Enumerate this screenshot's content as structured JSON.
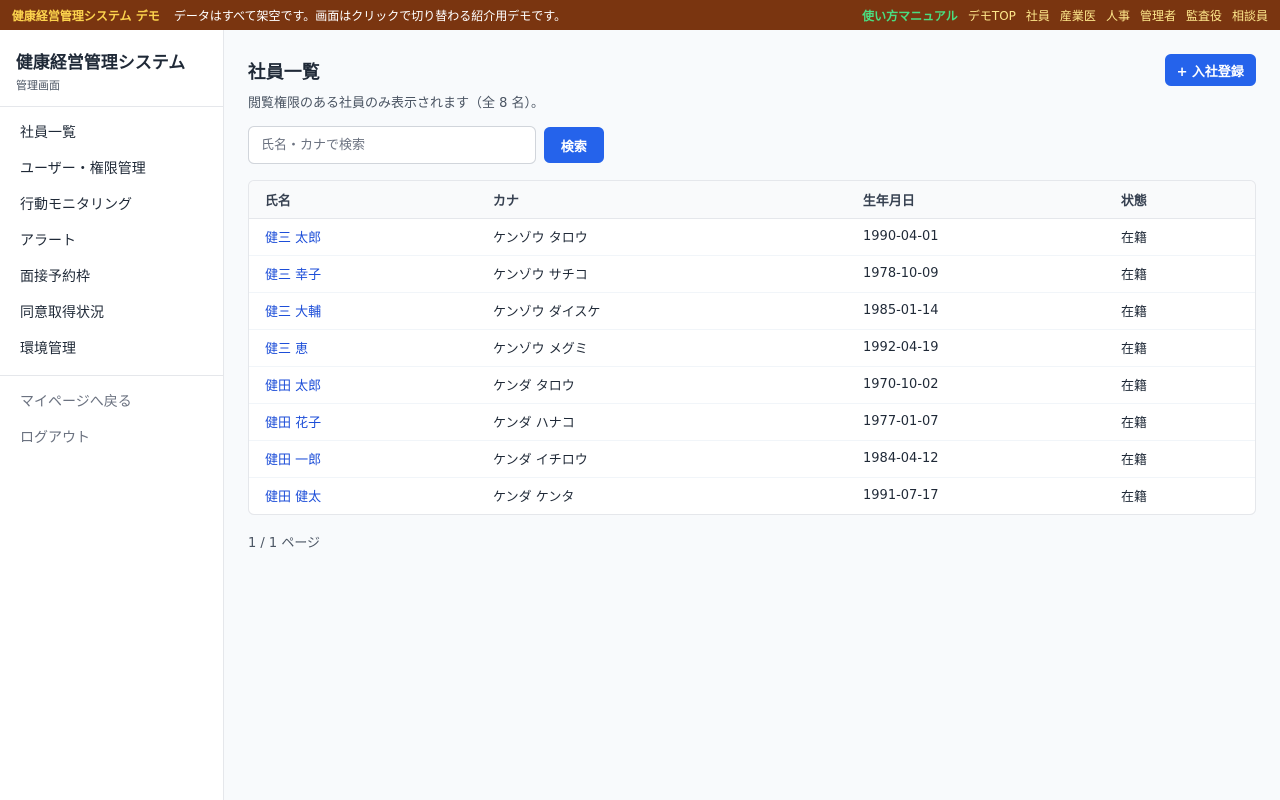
{
  "demo_bar": {
    "brand": "健康経営管理システム デモ",
    "note": "データはすべて架空です。画面はクリックで切り替わる紹介用デモです。",
    "links": [
      "使い方マニュアル",
      "デモTOP",
      "社員",
      "産業医",
      "人事",
      "管理者",
      "監査役",
      "相談員"
    ]
  },
  "sidebar": {
    "title": "健康経営管理システム",
    "subtitle": "管理画面",
    "items": [
      "社員一覧",
      "ユーザー・権限管理",
      "行動モニタリング",
      "アラート",
      "面接予約枠",
      "同意取得状況",
      "環境管理"
    ],
    "footer_items": [
      "マイページへ戻る",
      "ログアウト"
    ]
  },
  "main": {
    "title": "社員一覧",
    "description": "閲覧権限のある社員のみ表示されます（全 8 名）。",
    "add_button": "+ 入社登録",
    "search_placeholder": "氏名・カナで検索",
    "search_button": "検索",
    "table": {
      "headers": [
        "氏名",
        "カナ",
        "生年月日",
        "状態"
      ],
      "rows": [
        [
          "健三 太郎",
          "ケンゾウ タロウ",
          "1990-04-01",
          "在籍"
        ],
        [
          "健三 幸子",
          "ケンゾウ サチコ",
          "1978-10-09",
          "在籍"
        ],
        [
          "健三 大輔",
          "ケンゾウ ダイスケ",
          "1985-01-14",
          "在籍"
        ],
        [
          "健三 恵",
          "ケンゾウ メグミ",
          "1992-04-19",
          "在籍"
        ],
        [
          "健田 太郎",
          "ケンダ タロウ",
          "1970-10-02",
          "在籍"
        ],
        [
          "健田 花子",
          "ケンダ ハナコ",
          "1977-01-07",
          "在籍"
        ],
        [
          "健田 一郎",
          "ケンダ イチロウ",
          "1984-04-12",
          "在籍"
        ],
        [
          "健田 健太",
          "ケンダ ケンタ",
          "1991-07-17",
          "在籍"
        ]
      ]
    },
    "pager": "1 / 1 ページ"
  }
}
